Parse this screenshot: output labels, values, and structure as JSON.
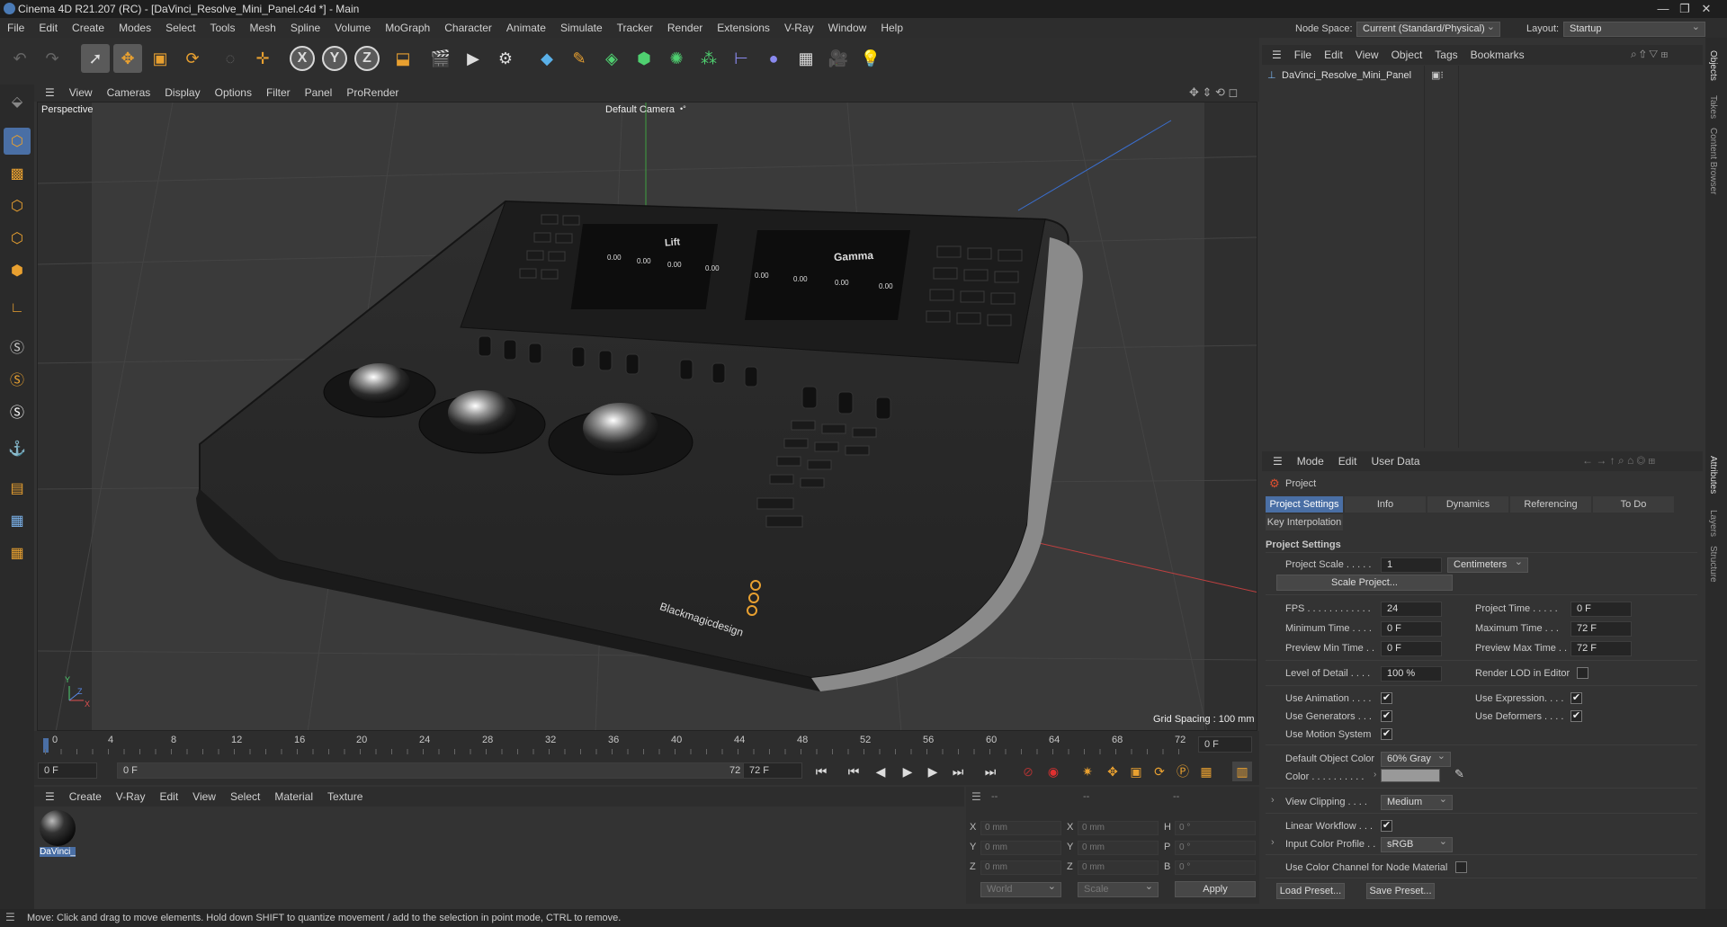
{
  "window": {
    "title": "Cinema 4D R21.207 (RC) - [DaVinci_Resolve_Mini_Panel.c4d *] - Main",
    "minimize": "—",
    "maximize": "❐",
    "close": "✕"
  },
  "menubar": {
    "items": [
      "File",
      "Edit",
      "Create",
      "Modes",
      "Select",
      "Tools",
      "Mesh",
      "Spline",
      "Volume",
      "MoGraph",
      "Character",
      "Animate",
      "Simulate",
      "Tracker",
      "Render",
      "Extensions",
      "V-Ray",
      "Window",
      "Help"
    ],
    "node_space_label": "Node Space:",
    "node_space_value": "Current (Standard/Physical)",
    "layout_label": "Layout:",
    "layout_value": "Startup"
  },
  "toolbar": {
    "x_label": "X",
    "y_label": "Y",
    "z_label": "Z"
  },
  "viewport": {
    "menu": [
      "View",
      "Cameras",
      "Display",
      "Options",
      "Filter",
      "Panel",
      "ProRender"
    ],
    "name": "Perspective",
    "camera": "Default Camera",
    "camera_suffix": "•°",
    "grid_spacing": "Grid Spacing : 100 mm",
    "screens": {
      "left_title": "Lift",
      "right_title": "Gamma",
      "value": "0.00"
    },
    "brand": "Blackmagicdesign",
    "axes": {
      "x": "X",
      "y": "Y",
      "z": "Z"
    }
  },
  "timeline": {
    "ticks": [
      "0",
      "4",
      "8",
      "12",
      "16",
      "20",
      "24",
      "28",
      "32",
      "36",
      "40",
      "44",
      "48",
      "52",
      "56",
      "60",
      "64",
      "68",
      "72"
    ],
    "current_frame_field": "0 F",
    "start_field": "0 F",
    "range_start": "0 F",
    "range_end": "72 F",
    "end_field": "72 F"
  },
  "material_manager": {
    "menu": [
      "Create",
      "V-Ray",
      "Edit",
      "View",
      "Select",
      "Material",
      "Texture"
    ],
    "materials": [
      {
        "name": "DaVinci_"
      }
    ]
  },
  "coordinates": {
    "header": [
      "--",
      "--",
      "--"
    ],
    "rows": [
      {
        "a": "X",
        "av": "0 mm",
        "b": "X",
        "bv": "0 mm",
        "c": "H",
        "cv": "0 °"
      },
      {
        "a": "Y",
        "av": "0 mm",
        "b": "Y",
        "bv": "0 mm",
        "c": "P",
        "cv": "0 °"
      },
      {
        "a": "Z",
        "av": "0 mm",
        "b": "Z",
        "bv": "0 mm",
        "c": "B",
        "cv": "0 °"
      }
    ],
    "mode1": "World",
    "mode2": "Scale",
    "apply": "Apply"
  },
  "objects": {
    "menu": [
      "File",
      "Edit",
      "View",
      "Object",
      "Tags",
      "Bookmarks"
    ],
    "items": [
      {
        "name": "DaVinci_Resolve_Mini_Panel"
      }
    ]
  },
  "side_tabs": {
    "top": [
      "Objects",
      "Takes",
      "Content Browser"
    ],
    "bottom": [
      "Attributes",
      "Layers",
      "Structure"
    ]
  },
  "attributes": {
    "menu": [
      "Mode",
      "Edit",
      "User Data"
    ],
    "object": "Project",
    "tabs": [
      "Project Settings",
      "Info",
      "Dynamics",
      "Referencing",
      "To Do"
    ],
    "tab2": "Key Interpolation",
    "section": "Project Settings",
    "project_scale_label": "Project Scale . . . . .",
    "project_scale_value": "1",
    "project_scale_unit": "Centimeters",
    "scale_project_btn": "Scale Project...",
    "fps_label": "FPS . . . . . . . . . . . .",
    "fps_value": "24",
    "project_time_label": "Project Time . . . . .",
    "project_time_value": "0 F",
    "min_time_label": "Minimum Time . . . .",
    "min_time_value": "0 F",
    "max_time_label": "Maximum Time . . .",
    "max_time_value": "72 F",
    "prev_min_label": "Preview Min Time . .",
    "prev_min_value": "0 F",
    "prev_max_label": "Preview Max Time . .",
    "prev_max_value": "72 F",
    "lod_label": "Level of Detail . . . .",
    "lod_value": "100 %",
    "render_lod_label": "Render LOD in Editor",
    "use_animation_label": "Use Animation . . . .",
    "use_expression_label": "Use Expression. . . .",
    "use_generators_label": "Use Generators . . .",
    "use_deformers_label": "Use Deformers . . . .",
    "use_motion_label": "Use Motion System",
    "default_color_label": "Default Object Color",
    "default_color_value": "60% Gray",
    "color_label": "Color . . . . . . . . . .",
    "view_clipping_label": "View Clipping . . . .",
    "view_clipping_value": "Medium",
    "linear_label": "Linear Workflow . . .",
    "input_profile_label": "Input Color Profile . .",
    "input_profile_value": "sRGB",
    "color_channel_label": "Use Color Channel for Node Material",
    "load_preset": "Load Preset...",
    "save_preset": "Save Preset...",
    "check": "✔"
  },
  "status": {
    "text": "Move: Click and drag to move elements. Hold down SHIFT to quantize movement / add to the selection in point mode, CTRL to remove."
  },
  "colors": {
    "accent": "#4a6fa5",
    "orange": "#e8a030"
  }
}
